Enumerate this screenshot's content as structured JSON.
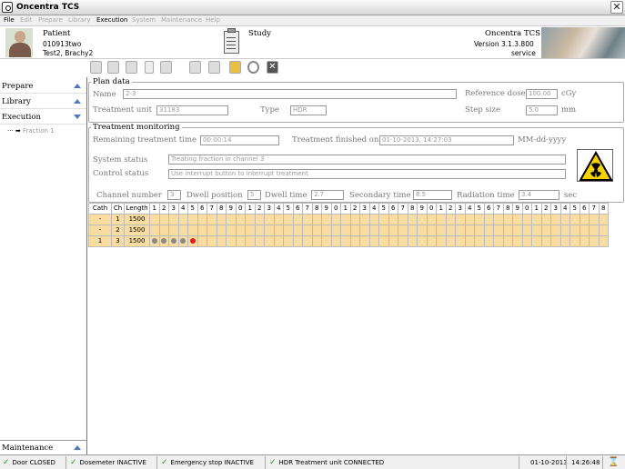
{
  "app": {
    "title": "Oncentra TCS"
  },
  "menu": [
    "File",
    "Edit",
    "Prepare",
    "Library",
    "Execution",
    "System",
    "Maintenance",
    "Help"
  ],
  "header": {
    "patient_label": "Patient",
    "patient_id": "010913two",
    "patient_name": "Test2, Brachy2",
    "study_label": "Study",
    "product": "Oncentra TCS",
    "version": "Version 3.1.3.800",
    "mode": "service"
  },
  "sidebar": {
    "items": [
      {
        "label": "Prepare"
      },
      {
        "label": "Library"
      },
      {
        "label": "Execution"
      }
    ],
    "fraction": "Fraction 1",
    "bottom": "Maintenance"
  },
  "plan": {
    "title": "Plan data",
    "name_label": "Name",
    "name_value": "2-3",
    "unit_label": "Treatment unit",
    "unit_value": "31183",
    "type_label": "Type",
    "type_value": "HDR",
    "ref_label": "Reference dose",
    "ref_value": "100.00",
    "ref_unit": "cGy",
    "step_label": "Step size",
    "step_value": "5.0",
    "step_unit": "mm"
  },
  "monitor": {
    "title": "Treatment monitoring",
    "remaining_label": "Remaining treatment time",
    "remaining_value": "00:00:14",
    "finished_label": "Treatment finished on",
    "finished_value": "01-10-2013, 14:27:03",
    "date_format": "MM-dd-yyyy",
    "system_label": "System status",
    "system_value": "Treating fraction in channel 3",
    "control_label": "Control status",
    "control_value": "Use interrupt button to interrupt treatment",
    "channel_label": "Channel number",
    "channel_value": "3",
    "dwell_pos_label": "Dwell position",
    "dwell_pos_value": "5",
    "dwell_time_label": "Dwell time",
    "dwell_time_value": "2.7",
    "secondary_label": "Secondary time",
    "secondary_value": "8.5",
    "radiation_label": "Radiation time",
    "radiation_value": "3.4",
    "sec_unit": "sec"
  },
  "grid": {
    "headers": [
      "Cath",
      "Ch",
      "Length"
    ],
    "numbers": [
      "1",
      "2",
      "3",
      "4",
      "5",
      "6",
      "7",
      "8",
      "9",
      "0",
      "1",
      "2",
      "3",
      "4",
      "5",
      "6",
      "7",
      "8",
      "9",
      "0",
      "1",
      "2",
      "3",
      "4",
      "5",
      "6",
      "7",
      "8",
      "9",
      "0",
      "1",
      "2",
      "3",
      "4",
      "5",
      "6",
      "7",
      "8",
      "9",
      "0",
      "1",
      "2",
      "3",
      "4",
      "5",
      "6",
      "7",
      "8"
    ],
    "rows": [
      {
        "cath": "-",
        "ch": "1",
        "length": "1500",
        "done": 0,
        "active": 0
      },
      {
        "cath": "-",
        "ch": "2",
        "length": "1500",
        "done": 0,
        "active": 0
      },
      {
        "cath": "1",
        "ch": "3",
        "length": "1500",
        "done": 4,
        "active": 5
      }
    ]
  },
  "status": {
    "door": "Door CLOSED",
    "dosemeter": "Dosemeter INACTIVE",
    "estop": "Emergency stop INACTIVE",
    "unit": "HDR Treatment unit CONNECTED",
    "date": "01-10-2013",
    "time": "14:26:48"
  },
  "colors": {
    "row_fill": "#f8dca0",
    "active_dot": "#e02020",
    "done_dot": "#888888",
    "accent": "#4a78c8"
  }
}
